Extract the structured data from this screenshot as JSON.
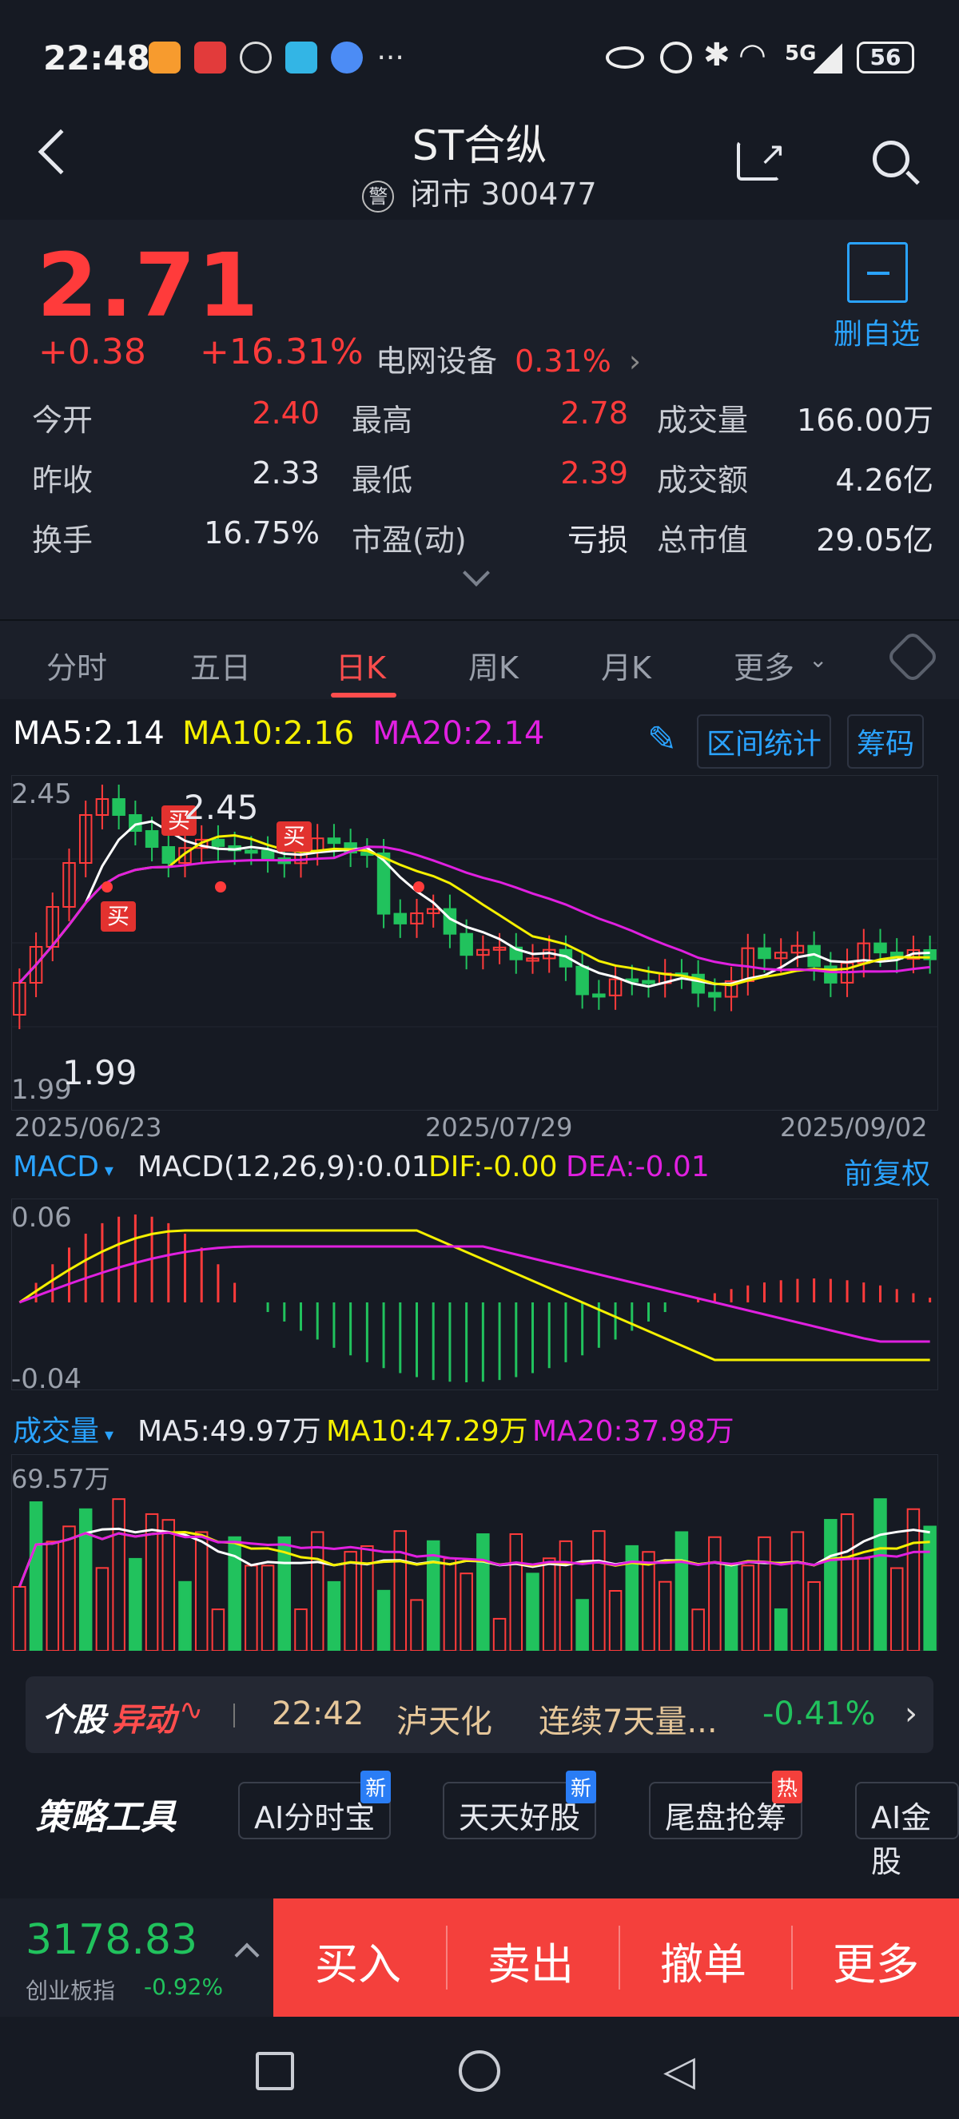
{
  "status_bar": {
    "time": "22:48",
    "network": "5G",
    "battery": "56"
  },
  "header": {
    "title": "ST合纵",
    "warn_mark": "警",
    "market_state": "闭市",
    "code": "300477"
  },
  "quote": {
    "price": "2.71",
    "change": "+0.38",
    "change_pct": "+16.31%",
    "sector": "电网设备",
    "sector_pct": "0.31%",
    "watch_btn": "删自选",
    "rows": [
      [
        {
          "k": "今开",
          "v": "2.40"
        },
        {
          "k": "最高",
          "v": "2.78"
        },
        {
          "k": "成交量",
          "v": "166.00万"
        }
      ],
      [
        {
          "k": "昨收",
          "v": "2.33"
        },
        {
          "k": "最低",
          "v": "2.39"
        },
        {
          "k": "成交额",
          "v": "4.26亿"
        }
      ],
      [
        {
          "k": "换手",
          "v": "16.75%"
        },
        {
          "k": "市盈(动)",
          "v": "亏损"
        },
        {
          "k": "总市值",
          "v": "29.05亿"
        }
      ]
    ]
  },
  "tabs": [
    "分时",
    "五日",
    "日K",
    "周K",
    "月K",
    "更多"
  ],
  "active_tab": "日K",
  "kline": {
    "ma5": "MA5:2.14",
    "ma10": "MA10:2.16",
    "ma20": "MA20:2.14",
    "range_stats": "区间统计",
    "chips": "筹码",
    "ymax": "2.45",
    "ymin": "1.99",
    "high_label": "2.45",
    "low_label": "1.99",
    "buy_label": "买",
    "dates": [
      "2025/06/23",
      "2025/07/29",
      "2025/09/02"
    ],
    "colors": {
      "up": "#ff3b3b",
      "down": "#21c25d",
      "ma5": "#ffffff",
      "ma10": "#f5f000",
      "ma20": "#e020e0"
    }
  },
  "macd": {
    "label": "MACD",
    "params": "MACD(12,26,9):0.01",
    "dif": "DIF:-0.00",
    "dea": "DEA:-0.01",
    "adjust": "前复权",
    "ymax": "0.06",
    "ymin": "-0.04"
  },
  "volume": {
    "label": "成交量",
    "ma5": "MA5:49.97万",
    "ma10": "MA10:47.29万",
    "ma20": "MA20:37.98万",
    "ymax": "69.57万"
  },
  "news": {
    "brand_a": "个股",
    "brand_b": "异动",
    "time": "22:42",
    "stock": "泸天化",
    "text": "连续7天量...",
    "pct": "-0.41%"
  },
  "tools": {
    "title": "策略工具",
    "items": [
      {
        "label": "AI分时宝",
        "badge": "新"
      },
      {
        "label": "天天好股",
        "badge": "新"
      },
      {
        "label": "尾盘抢筹",
        "badge": "热"
      },
      {
        "label": "AI金股",
        "badge": ""
      }
    ]
  },
  "index": {
    "value": "3178.83",
    "name": "创业板指",
    "pct": "-0.92%"
  },
  "trade": [
    "买入",
    "卖出",
    "撤单",
    "更多"
  ]
}
